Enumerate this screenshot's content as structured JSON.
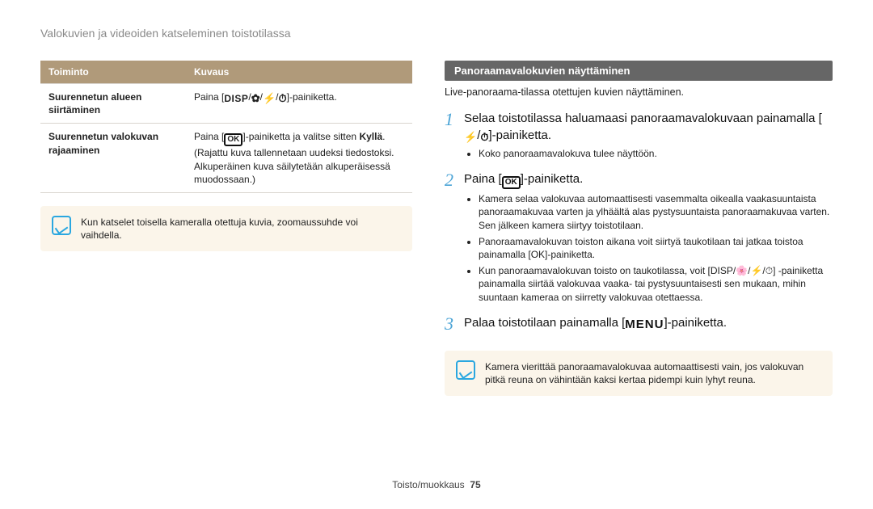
{
  "breadcrumb": "Valokuvien ja videoiden katseleminen toistotilassa",
  "table": {
    "headers": [
      "Toiminto",
      "Kuvaus"
    ],
    "rows": [
      {
        "label": "Suurennetun alueen siirtäminen",
        "desc_prefix": "Paina [",
        "desc_suffix": "]-painiketta."
      },
      {
        "label": "Suurennetun valokuvan rajaaminen",
        "desc_prefix": "Paina [",
        "desc_mid": "]-painiketta ja valitse sitten ",
        "bold": "Kyllä",
        "desc_suffix": ". (Rajattu kuva tallennetaan uudeksi tiedostoksi. Alkuperäinen kuva säilytetään alkuperäisessä muodossaan.)"
      }
    ]
  },
  "note_left": "Kun katselet toisella kameralla otettuja kuvia, zoomaussuhde voi vaihdella.",
  "section_title": "Panoraamavalokuvien näyttäminen",
  "lead": "Live-panoraama-tilassa otettujen kuvien näyttäminen.",
  "steps": [
    {
      "headline_pre": "Selaa toistotilassa haluamaasi panoraamavalokuvaan painamalla [",
      "headline_post": "]-painiketta.",
      "bullets": [
        "Koko panoraamavalokuva tulee näyttöön."
      ]
    },
    {
      "headline_pre": "Paina [",
      "headline_post": "]-painiketta.",
      "bullets": [
        "Kamera selaa valokuvaa automaattisesti vasemmalta oikealla vaakasuuntaista panoraamakuvaa varten ja ylhäältä alas pystysuuntaista panoraamakuvaa varten. Sen jälkeen kamera siirtyy toistotilaan.",
        "Panoraamavalokuvan toiston aikana voit siirtyä taukotilaan tai jatkaa toistoa painamalla [OK]-painiketta.",
        "Kun panoraamavalokuvan toisto on taukotilassa, voit [DISP/🌸/⚡/⏱] -painiketta painamalla siirtää valokuvaa vaaka- tai pystysuuntaisesti sen mukaan, mihin suuntaan kameraa on siirretty valokuvaa otettaessa."
      ]
    },
    {
      "headline_pre": "Palaa toistotilaan painamalla [",
      "headline_post": "]-painiketta."
    }
  ],
  "note_right": "Kamera vierittää panoraamavalokuvaa automaattisesti vain, jos valokuvan pitkä reuna on vähintään kaksi kertaa pidempi kuin lyhyt reuna.",
  "footer": {
    "section": "Toisto/muokkaus",
    "page": "75"
  },
  "glyphs": {
    "disp": "DISP",
    "ok": "OK",
    "menu": "MENU",
    "flower": "✿",
    "flash": "⚡",
    "timer": "⏱"
  }
}
